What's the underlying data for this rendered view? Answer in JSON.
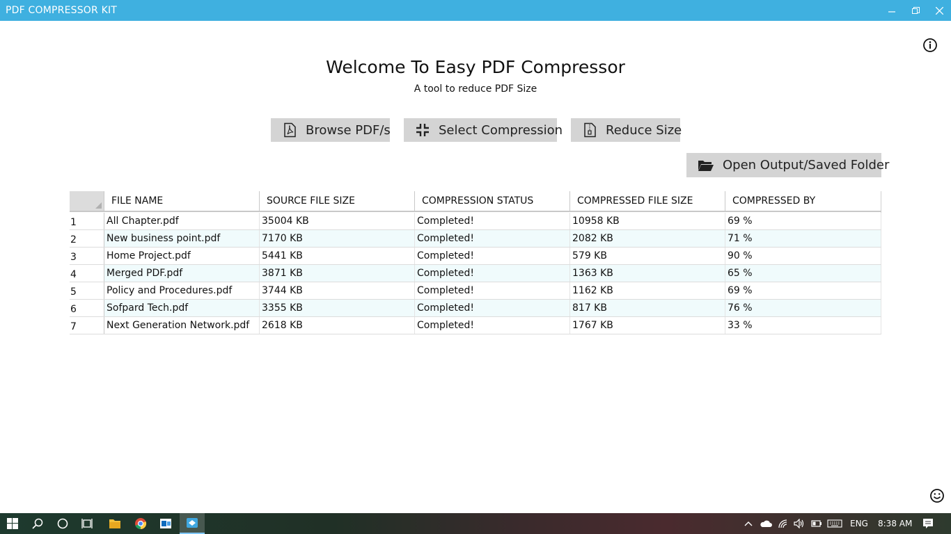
{
  "window": {
    "title": "PDF COMPRESSOR KIT",
    "controls": [
      "minimize",
      "restore",
      "close"
    ]
  },
  "header": {
    "title": "Welcome To Easy PDF Compressor",
    "subtitle": "A tool to reduce PDF Size"
  },
  "toolbar": {
    "browse_label": "Browse PDF/s",
    "select_compression_label": "Select Compression",
    "reduce_size_label": "Reduce Size",
    "open_output_label": "Open Output/Saved Folder"
  },
  "table": {
    "columns": [
      "FILE NAME",
      "SOURCE FILE SIZE",
      "COMPRESSION STATUS",
      "COMPRESSED FILE SIZE",
      "COMPRESSED BY"
    ],
    "rows": [
      {
        "num": "1",
        "file": "All Chapter.pdf",
        "source": "35004 KB",
        "status": "Completed!",
        "compressed": "10958 KB",
        "by": "69 %"
      },
      {
        "num": "2",
        "file": "New business point.pdf",
        "source": "7170 KB",
        "status": "Completed!",
        "compressed": "2082 KB",
        "by": "71 %"
      },
      {
        "num": "3",
        "file": "Home Project.pdf",
        "source": "5441 KB",
        "status": "Completed!",
        "compressed": "579 KB",
        "by": "90 %"
      },
      {
        "num": "4",
        "file": "Merged PDF.pdf",
        "source": "3871 KB",
        "status": "Completed!",
        "compressed": "1363 KB",
        "by": "65 %"
      },
      {
        "num": "5",
        "file": "Policy and Procedures.pdf",
        "source": "3744 KB",
        "status": "Completed!",
        "compressed": "1162 KB",
        "by": "69 %"
      },
      {
        "num": "6",
        "file": "Sofpard Tech.pdf",
        "source": "3355 KB",
        "status": "Completed!",
        "compressed": "817 KB",
        "by": "76 %"
      },
      {
        "num": "7",
        "file": "Next Generation Network.pdf",
        "source": "2618 KB",
        "status": "Completed!",
        "compressed": "1767 KB",
        "by": "33 %"
      }
    ]
  },
  "taskbar": {
    "language": "ENG",
    "time": "8:38 AM",
    "icons": [
      "windows-start-icon",
      "search-icon",
      "cortana-icon",
      "task-view-icon",
      "file-explorer-icon",
      "chrome-icon",
      "outlook-icon",
      "pdf-compressor-app-icon"
    ]
  },
  "colors": {
    "titlebar": "#3fb0e0",
    "button_bg": "#d4d4d4",
    "alt_row": "#f0fbfc"
  }
}
